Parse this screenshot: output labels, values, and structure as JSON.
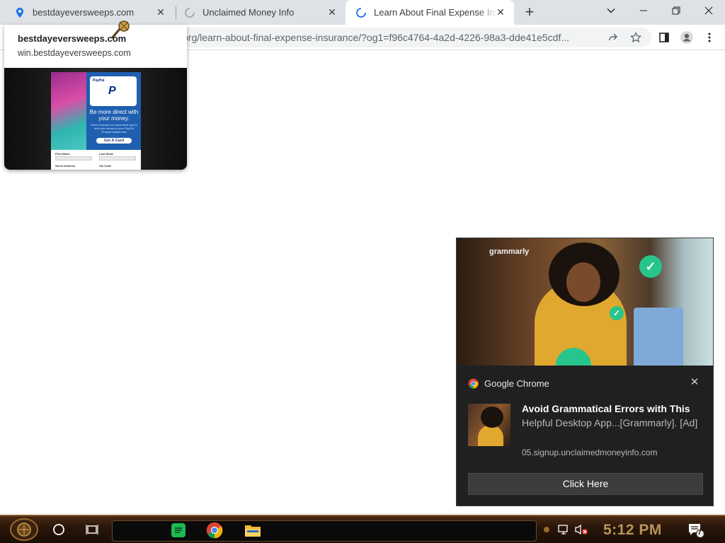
{
  "browser": {
    "tabs": [
      {
        "title": "bestdayeversweeps.com",
        "active": false
      },
      {
        "title": "Unclaimed Money Info",
        "active": false
      },
      {
        "title": "Learn About Final Expense Insurance",
        "active": true
      }
    ],
    "url_visible": "org/learn-about-final-expense-insurance/?og1=f96c4764-4a2d-4226-98a3-dde41e5cdf..."
  },
  "hover_card": {
    "title": "bestdayeversweeps.com",
    "domain": "win.bestdayeversweeps.com",
    "preview": {
      "card_brand": "PayPal",
      "headline": "Be more direct with your money.",
      "body": "Direct Deposit is a convenient way to add your money to your PayPal Prepaid Mastercard",
      "button": "Get A Card",
      "form_labels": [
        "First Name",
        "Last Name",
        "Street Address",
        "Zip Code"
      ]
    }
  },
  "notification": {
    "image_brand": "grammarly",
    "app_name": "Google Chrome",
    "title": "Avoid Grammatical Errors with This",
    "body": "Helpful Desktop App...[Grammarly]. [Ad]",
    "source": "05.signup.unclaimedmoneyinfo.com",
    "button": "Click Here"
  },
  "taskbar": {
    "clock": "5:12 PM",
    "notification_count": "7"
  },
  "colors": {
    "tab_strip": "#dee1e6",
    "chrome_blue": "#1a73e8",
    "notification_bg": "#202020",
    "taskbar_bronze": "#b8935a"
  }
}
